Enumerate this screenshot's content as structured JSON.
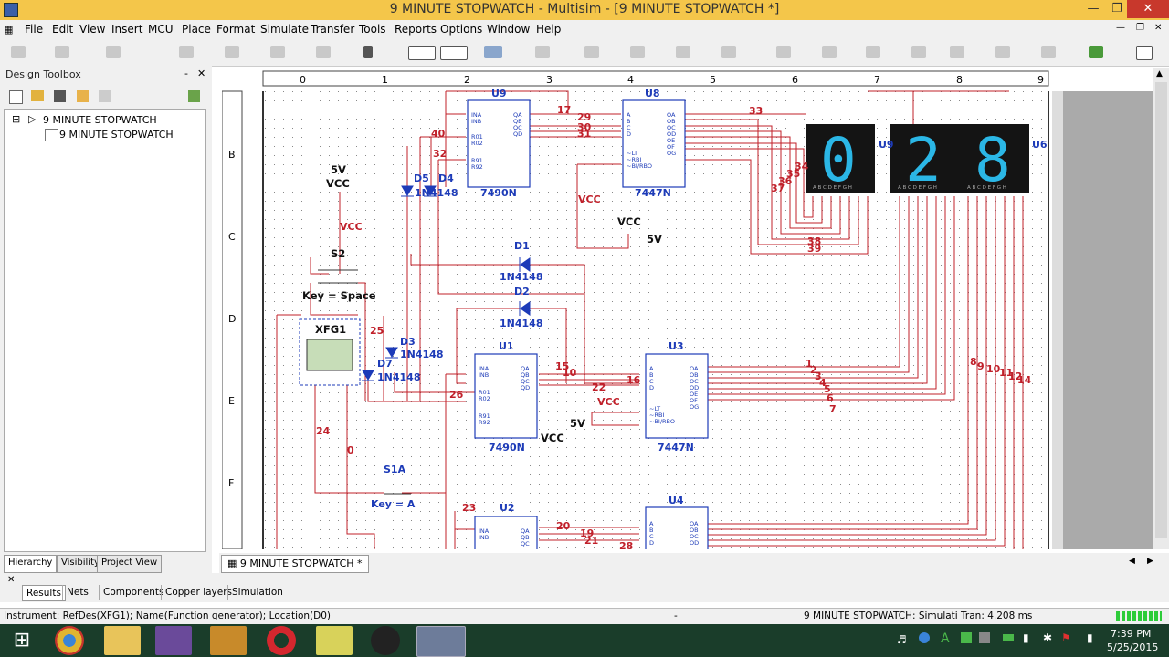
{
  "window": {
    "title": "9 MINUTE STOPWATCH - Multisim - [9 MINUTE STOPWATCH *]"
  },
  "menu": [
    "File",
    "Edit",
    "View",
    "Insert",
    "MCU",
    "Place",
    "Format",
    "Simulate",
    "Transfer",
    "Tools",
    "Reports",
    "Options",
    "Window",
    "Help"
  ],
  "toolbox": {
    "title": "Design Toolbox",
    "root": "9 MINUTE STOPWATCH",
    "child": "9 MINUTE STOPWATCH",
    "tabs": [
      "Hierarchy",
      "Visibility",
      "Project View"
    ]
  },
  "ruler_top": [
    "0",
    "1",
    "2",
    "3",
    "4",
    "5",
    "6",
    "7",
    "8",
    "9"
  ],
  "ruler_left": [
    "B",
    "C",
    "D",
    "E",
    "F"
  ],
  "schematic": {
    "labels": {
      "u1": "U1",
      "u2": "U2",
      "u3": "U3",
      "u4": "U4",
      "u6": "U6",
      "u9": "U9",
      "c7490_top": "7490N",
      "c7447_top": "7447N",
      "c7490_mid": "7490N",
      "c7447_mid": "7447N",
      "d1": "D1",
      "d2": "D2",
      "d3": "D3",
      "d4": "D4",
      "d5": "D5",
      "d7": "D7",
      "diode_part": "1N4148",
      "diode_part_short": "1N4148",
      "d5d4_part": "1N4148",
      "s2": "S2",
      "key_space": "Key = Space",
      "s1a": "S1A",
      "key_a": "Key = A",
      "xfg1": "XFG1",
      "vcc": "VCC",
      "v5": "5V",
      "n17": "17",
      "n29": "29",
      "n30": "30",
      "n31": "31",
      "n32": "32",
      "n40": "40",
      "n33": "33",
      "n34": "34",
      "n35": "35",
      "n36": "36",
      "n37": "37",
      "n38": "38",
      "n39": "39",
      "n25": "25",
      "n24": "24",
      "n0": "0",
      "n26": "26",
      "n15": "15",
      "n10": "10",
      "n22": "22",
      "n16": "16",
      "n23": "23",
      "n20": "20",
      "n19": "19",
      "n21": "21",
      "n28": "28",
      "n_seq1": "1",
      "n_seq2": "2",
      "n_seq3": "3",
      "n_seq4": "4",
      "n_seq5": "5",
      "n_seq6": "6",
      "n_seq7": "7",
      "n8": "8",
      "n9": "9",
      "n10b": "10",
      "n11": "11",
      "n12": "12",
      "n13": "13",
      "n14": "14"
    },
    "digits": [
      "0",
      "2",
      "8"
    ],
    "segment_letters": "A B C D E F G H"
  },
  "doc_tab": "9 MINUTE STOPWATCH *",
  "bottom_tabs": [
    "Results",
    "Nets",
    "Components",
    "Copper layers",
    "Simulation"
  ],
  "status": {
    "instrument": "Instrument: RefDes(XFG1); Name(Function generator); Location(D0)",
    "dash": "-",
    "sim": "9 MINUTE STOPWATCH: Simulati  Tran: 4.208 ms"
  },
  "clock": {
    "time": "7:39 PM",
    "date": "5/25/2015"
  }
}
